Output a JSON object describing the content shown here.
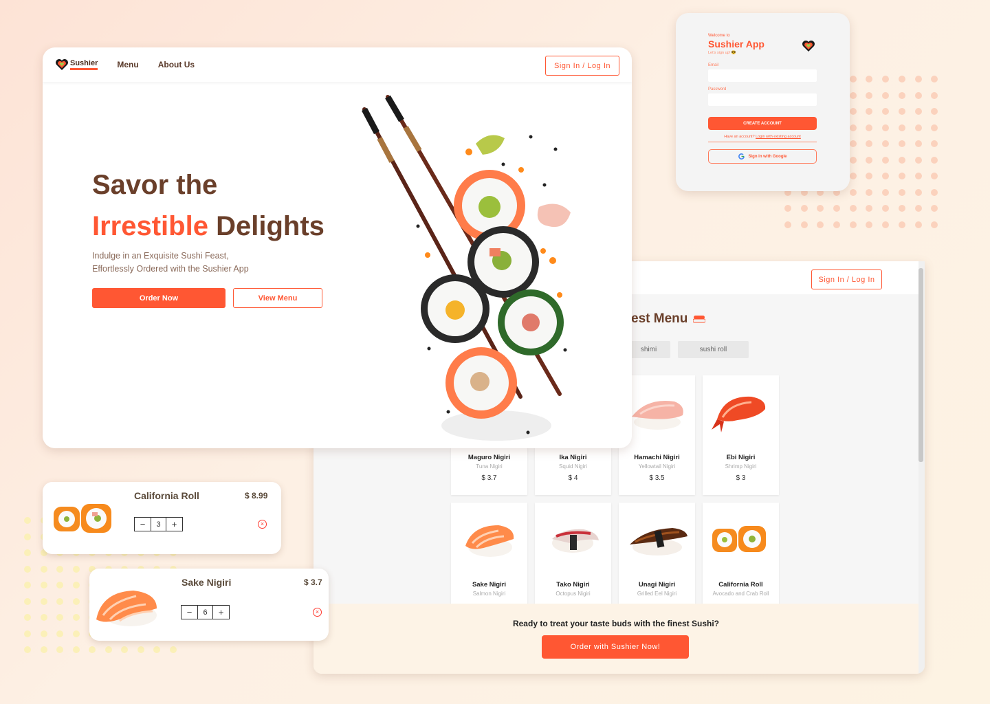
{
  "hero": {
    "brand": "Sushier",
    "nav": [
      "Menu",
      "About Us"
    ],
    "sign_in": "Sign In / Log In",
    "title_line1": "Savor the",
    "title_accent": "Irrestible",
    "title_rest": "Delights",
    "subtitle_line1": "Indulge in an Exquisite Sushi Feast,",
    "subtitle_line2": "Effortlessly Ordered with the Sushier App",
    "order_now": "Order Now",
    "view_menu": "View Menu"
  },
  "signup": {
    "welcome": "Welcome to",
    "title": "Sushier App",
    "sub": "Let's sign up! 😎",
    "email_label": "Email",
    "password_label": "Password",
    "create": "CREATE ACCOUNT",
    "have_account": "Have an account?",
    "login_link": "Login with existing account",
    "google": "Sign in with Google"
  },
  "menu": {
    "sign_in": "Sign In / Log In",
    "heading": "est Menu",
    "chips": [
      "shimi",
      "sushi roll"
    ],
    "items_row1": [
      {
        "name": "Maguro Nigiri",
        "sub": "Tuna Nigiri",
        "price": "$ 3.7"
      },
      {
        "name": "Ika Nigiri",
        "sub": "Squid Nigiri",
        "price": "$ 4"
      },
      {
        "name": "Hamachi Nigiri",
        "sub": "Yellowtail Nigiri",
        "price": "$ 3.5"
      },
      {
        "name": "Ebi Nigiri",
        "sub": "Shrimp Nigiri",
        "price": "$ 3"
      }
    ],
    "items_row2": [
      {
        "name": "Sake Nigiri",
        "sub": "Salmon Nigiri"
      },
      {
        "name": "Tako Nigiri",
        "sub": "Octopus Nigiri"
      },
      {
        "name": "Unagi Nigiri",
        "sub": "Grilled Eel Nigiri"
      },
      {
        "name": "California Roll",
        "sub": "Avocado and Crab Roll"
      }
    ],
    "footer_question": "Ready to treat your taste buds with the finest Sushi?",
    "footer_button": "Order with Sushier Now!"
  },
  "cart": [
    {
      "name": "California Roll",
      "price": "$ 8.99",
      "qty": "3"
    },
    {
      "name": "Sake Nigiri",
      "price": "$ 3.7",
      "qty": "6"
    }
  ],
  "colors": {
    "accent": "#ff5733",
    "brown": "#6a3f2a"
  }
}
